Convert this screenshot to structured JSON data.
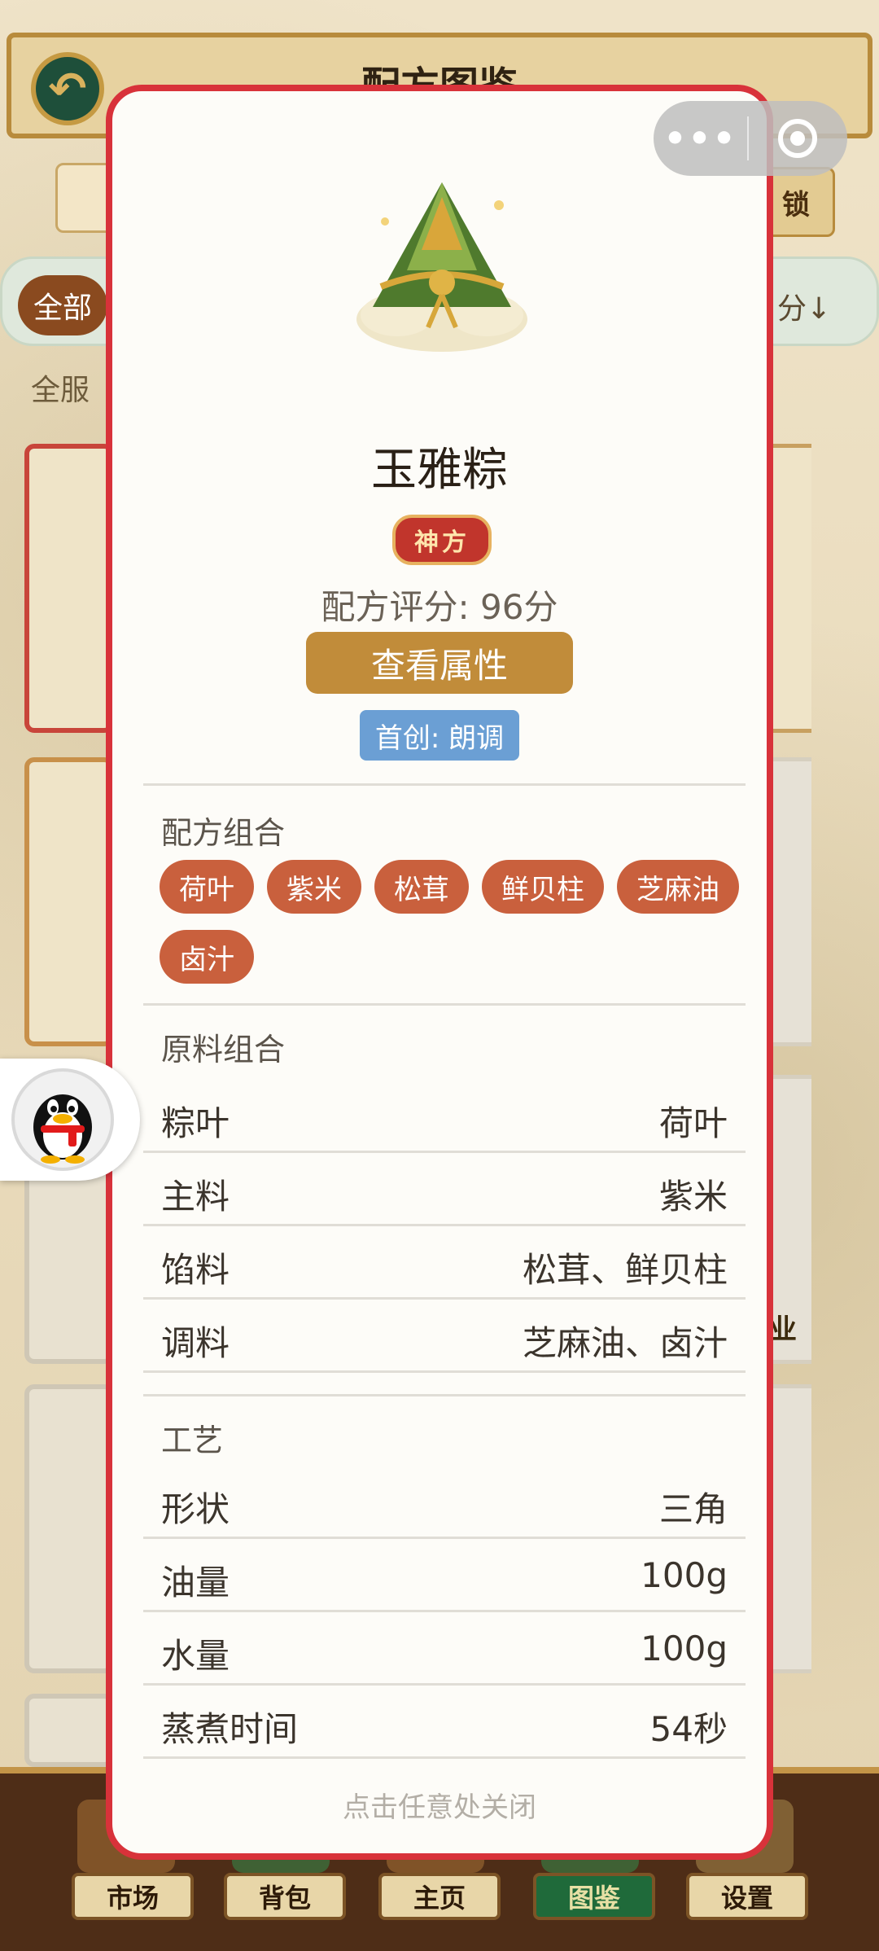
{
  "background": {
    "title": "配方图鉴",
    "lock_label": "锁",
    "filter_all": "全部",
    "sort_label": "分↓",
    "server_label": "全服",
    "side_text": "业",
    "nav": [
      "市场",
      "背包",
      "主页",
      "图鉴",
      "设置"
    ],
    "active_nav": "图鉴"
  },
  "capsule": {
    "more_icon": "more-dots-icon",
    "close_icon": "target-circle-icon"
  },
  "modal": {
    "dish_name": "玉雅粽",
    "rank": "神方",
    "score": "配方评分: 96分",
    "attr_button": "查看属性",
    "first_creator": "首创: 朗调",
    "recipe_section": "配方组合",
    "recipe_items": [
      "荷叶",
      "紫米",
      "松茸",
      "鲜贝柱",
      "芝麻油",
      "卤汁"
    ],
    "ingredients_section": "原料组合",
    "ingredients": [
      {
        "k": "粽叶",
        "v": "荷叶"
      },
      {
        "k": "主料",
        "v": "紫米"
      },
      {
        "k": "馅料",
        "v": "松茸、鲜贝柱"
      },
      {
        "k": "调料",
        "v": "芝麻油、卤汁"
      }
    ],
    "craft_section": "工艺",
    "craft": [
      {
        "k": "形状",
        "v": "三角"
      },
      {
        "k": "油量",
        "v": "100g"
      },
      {
        "k": "水量",
        "v": "100g"
      },
      {
        "k": "蒸煮时间",
        "v": "54秒"
      }
    ],
    "close_hint": "点击任意处关闭"
  },
  "colors": {
    "modal_border": "#d8323a",
    "chip": "#c9603d",
    "attr_button": "#c18c3a",
    "first_tag": "#6b9fd4",
    "rank_badge": "#c1352c"
  }
}
